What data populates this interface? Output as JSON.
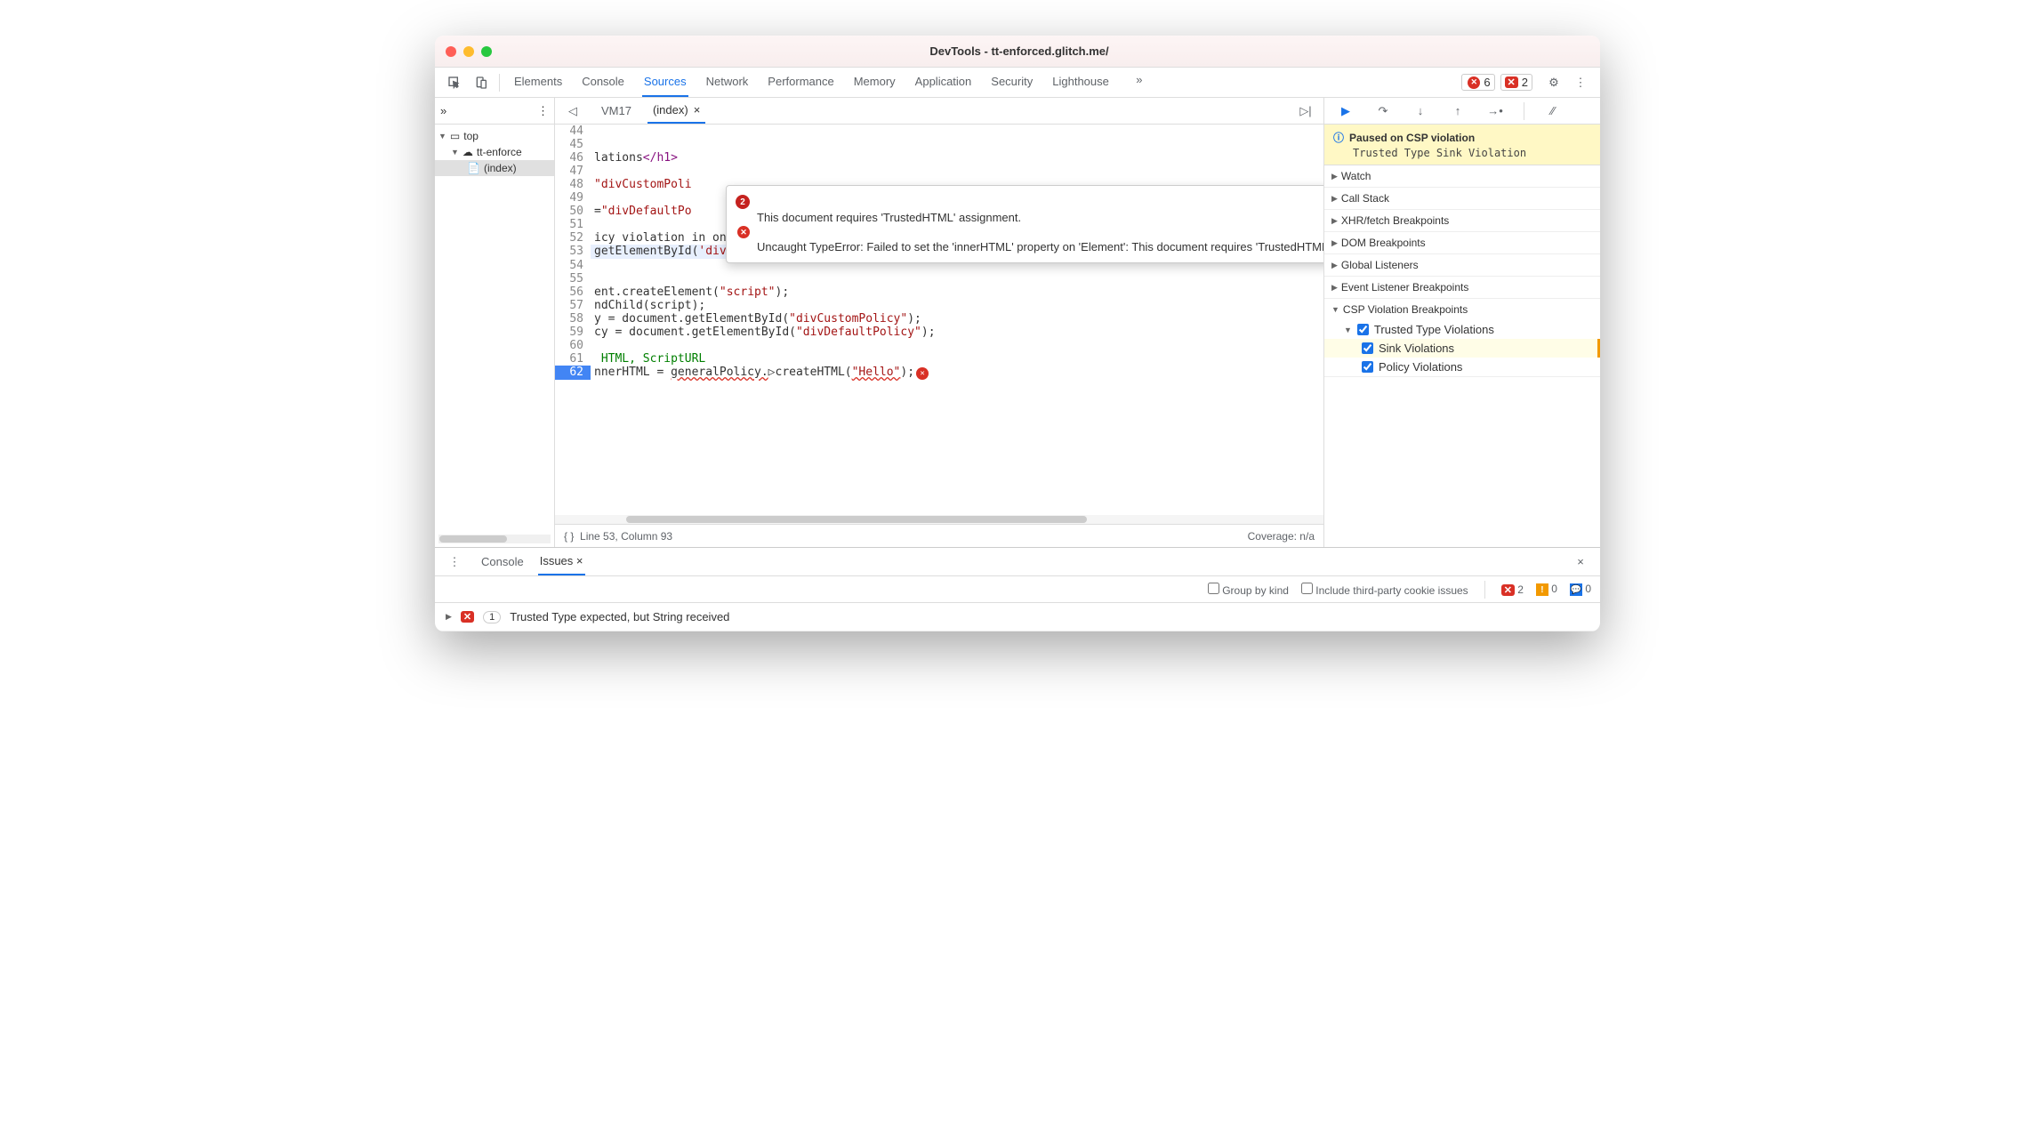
{
  "window": {
    "title": "DevTools - tt-enforced.glitch.me/"
  },
  "toolbar": {
    "tabs": [
      "Elements",
      "Console",
      "Sources",
      "Network",
      "Performance",
      "Memory",
      "Application",
      "Security",
      "Lighthouse"
    ],
    "active_tab": "Sources",
    "error_count": "6",
    "warn_count": "2"
  },
  "navigator": {
    "top": "top",
    "origin": "tt-enforce",
    "file": "(index)"
  },
  "file_tabs": {
    "vm": "VM17",
    "index": "(index)"
  },
  "code": {
    "lines": [
      {
        "n": "44",
        "t": ""
      },
      {
        "n": "45",
        "t": ""
      },
      {
        "n": "46",
        "t": "lations</h1>"
      },
      {
        "n": "47",
        "t": ""
      },
      {
        "n": "48",
        "t": "\"divCustomPoli"
      },
      {
        "n": "49",
        "t": ""
      },
      {
        "n": "50",
        "t": "=\"divDefaultPo"
      },
      {
        "n": "51",
        "t": ""
      },
      {
        "n": "52",
        "t": "icy violation in onclick: <button type=\"button\""
      },
      {
        "n": "53",
        "t": "getElementById('divCustomPolicy').innerHTML = 'aaa'\">Button</button>"
      },
      {
        "n": "54",
        "t": ""
      },
      {
        "n": "55",
        "t": ""
      },
      {
        "n": "56",
        "t": "ent.createElement(\"script\");"
      },
      {
        "n": "57",
        "t": "ndChild(script);"
      },
      {
        "n": "58",
        "t": "y = document.getElementById(\"divCustomPolicy\");"
      },
      {
        "n": "59",
        "t": "cy = document.getElementById(\"divDefaultPolicy\");"
      },
      {
        "n": "60",
        "t": ""
      },
      {
        "n": "61",
        "t": "HTML, ScriptURL"
      },
      {
        "n": "62",
        "t": "nnerHTML = generalPolicy.createHTML(\"Hello\");"
      }
    ]
  },
  "tooltip": {
    "count": "2",
    "msg1": "This document requires 'TrustedHTML' assignment.",
    "msg2": "Uncaught TypeError: Failed to set the 'innerHTML' property on 'Element': This document requires 'TrustedHTML' assignment."
  },
  "status": {
    "pos": "Line 53, Column 93",
    "coverage": "Coverage: n/a"
  },
  "debugger": {
    "paused_title": "Paused on CSP violation",
    "paused_sub": "Trusted Type Sink Violation",
    "panes": [
      "Watch",
      "Call Stack",
      "XHR/fetch Breakpoints",
      "DOM Breakpoints",
      "Global Listeners",
      "Event Listener Breakpoints",
      "CSP Violation Breakpoints"
    ],
    "csp": {
      "trusted": "Trusted Type Violations",
      "sink": "Sink Violations",
      "policy": "Policy Violations"
    }
  },
  "drawer": {
    "tabs": {
      "console": "Console",
      "issues": "Issues"
    },
    "group_by_kind": "Group by kind",
    "third_party": "Include third-party cookie issues",
    "counts": {
      "err": "2",
      "warn": "0",
      "info": "0"
    },
    "issue1": {
      "count": "1",
      "title": "Trusted Type expected, but String received"
    }
  }
}
